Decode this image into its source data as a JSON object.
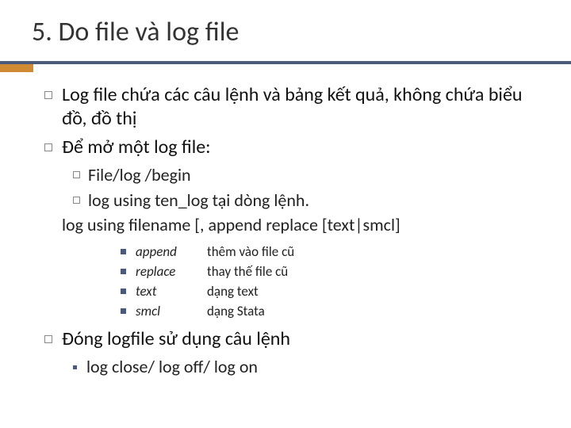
{
  "title": "5. Do file và log file",
  "bullets": {
    "b1": "Log file chứa các câu lệnh và bảng kết quả, không chứa biểu đồ, đồ thị",
    "b2": "Để mở một log file:",
    "b3": "Đóng logfile sử dụng câu lệnh"
  },
  "sub": {
    "s1": "File/log /begin",
    "s2": "log using ten_log tại dòng lệnh."
  },
  "syntax": "log using filename [, append replace [text|smcl]",
  "opts": [
    {
      "term": "append",
      "desc": "thêm vào file cũ"
    },
    {
      "term": "replace",
      "desc": "thay thế file cũ"
    },
    {
      "term": "text",
      "desc": "dạng text"
    },
    {
      "term": "smcl",
      "desc": "dạng Stata"
    }
  ],
  "close": "log close/ log off/ log on"
}
